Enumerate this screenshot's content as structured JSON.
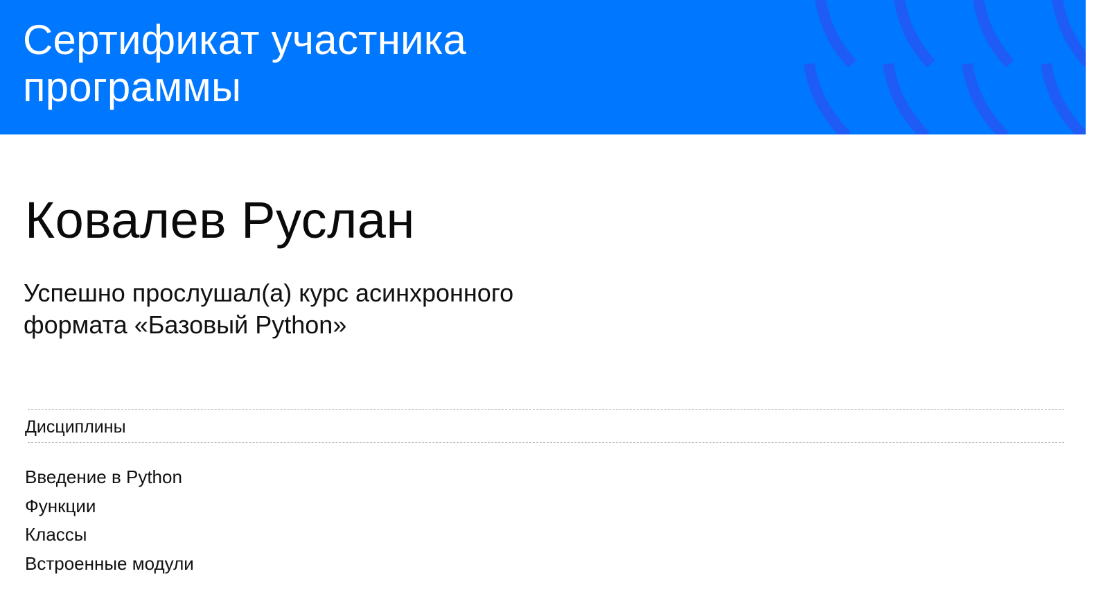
{
  "header": {
    "title_line1": "Сертификат участника",
    "title_line2": "программы",
    "background_color": "#0077ff",
    "decoration_color": "#1f5cf5"
  },
  "recipient": {
    "name": "Ковалев Руслан"
  },
  "completion": {
    "line1": "Успешно прослушал(а) курс асинхронного",
    "line2": "формата «Базовый Python»"
  },
  "disciplines": {
    "heading": "Дисциплины",
    "items": [
      "Введение в Python",
      "Функции",
      "Классы",
      "Встроенные модули"
    ]
  }
}
